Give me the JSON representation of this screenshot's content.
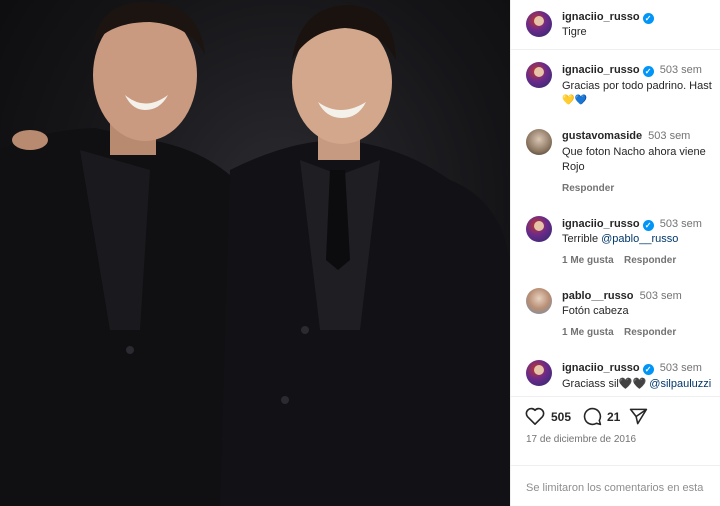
{
  "post": {
    "author": "ignaciio_russo",
    "location": "Tigre",
    "caption_author": "ignaciio_russo",
    "caption_time": "503 sem",
    "caption_text": "Gracias por todo padrino. Hast",
    "caption_emojis": "💛💙"
  },
  "comments": [
    {
      "user": "gustavomaside",
      "time": "503 sem",
      "line1": "Que foton Nacho ahora viene",
      "line2": "Rojo",
      "reply": "Responder"
    },
    {
      "user": "ignaciio_russo",
      "time": "503 sem",
      "prefix": "Terrible ",
      "mention": "@pablo__russo",
      "likes": "1 Me gusta",
      "reply": "Responder"
    },
    {
      "user": "pablo__russo",
      "time": "503 sem",
      "line1": "Fotón cabeza",
      "likes": "1 Me gusta",
      "reply": "Responder"
    },
    {
      "user": "ignaciio_russo",
      "time": "503 sem",
      "prefix": "Graciass sil🖤🖤 ",
      "mention": "@silpauluzzi"
    }
  ],
  "actions": {
    "likes_count": "505",
    "comments_count": "21",
    "date": "17 de diciembre de 2016"
  },
  "footer": {
    "notice": "Se limitaron los comentarios en esta"
  },
  "icons": [
    "heart-icon",
    "comment-icon",
    "share-icon",
    "verified-icon"
  ],
  "colors": {
    "verified": "#0095f6",
    "link": "#00376b",
    "meta": "#737373"
  }
}
